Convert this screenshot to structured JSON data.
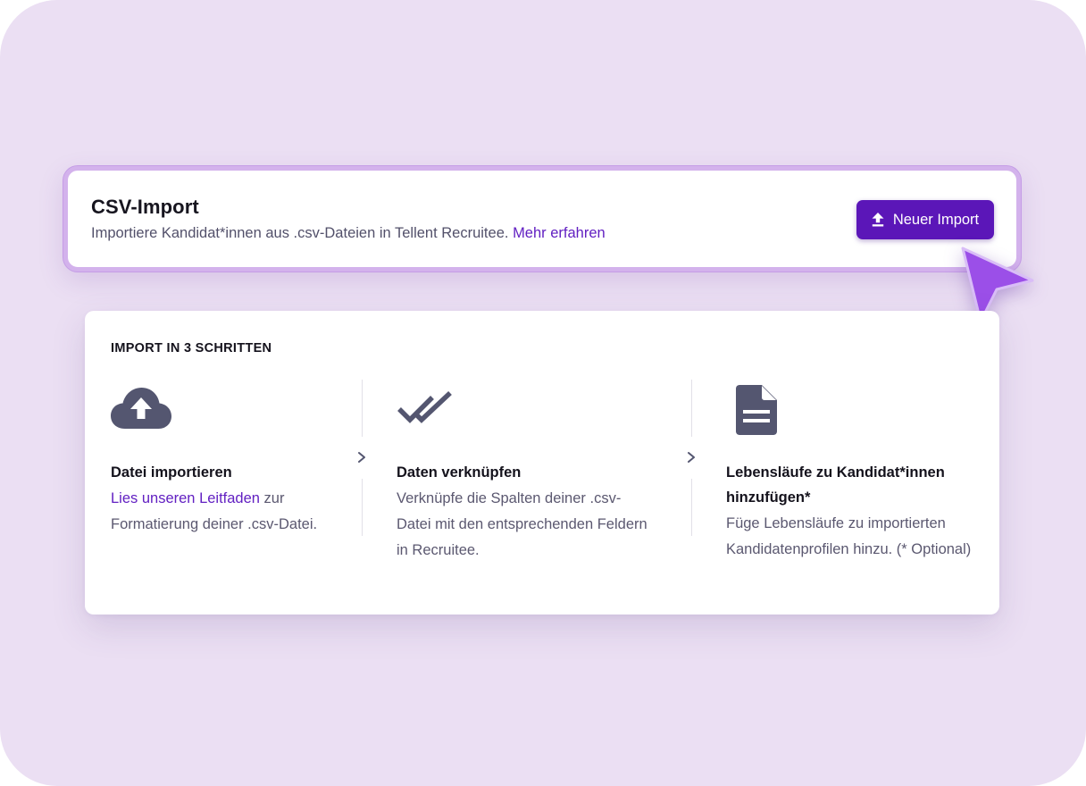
{
  "import_card": {
    "title": "CSV-Import",
    "description": "Importiere Kandidat*innen aus .csv-Dateien in Tellent Recruitee.",
    "learn_more_link": "Mehr erfahren",
    "new_import_button": "Neuer Import",
    "button_icon": "upload-icon"
  },
  "steps": {
    "heading": "IMPORT IN 3 SCHRITTEN",
    "items": [
      {
        "icon": "cloud-upload-icon",
        "title": "Datei importieren",
        "link": "Lies unseren Leitfaden",
        "text": " zur Formatierung deiner .csv-Datei."
      },
      {
        "icon": "double-check-icon",
        "title": "Daten verknüpfen",
        "text": "Verknüpfe die Spalten deiner .csv-Datei mit den entsprechenden Feldern in Recruitee."
      },
      {
        "icon": "document-icon",
        "title": "Lebensläufe zu Kandidat*innen hinzufügen*",
        "text": "Füge Lebensläufe zu importierten Kandidatenprofilen hinzu. (* Optional)"
      }
    ]
  },
  "colors": {
    "background": "#ebdff3",
    "accent": "#5b16b8",
    "link": "#6220c2",
    "icon": "#545670",
    "cursor": "#9b4fe8"
  }
}
